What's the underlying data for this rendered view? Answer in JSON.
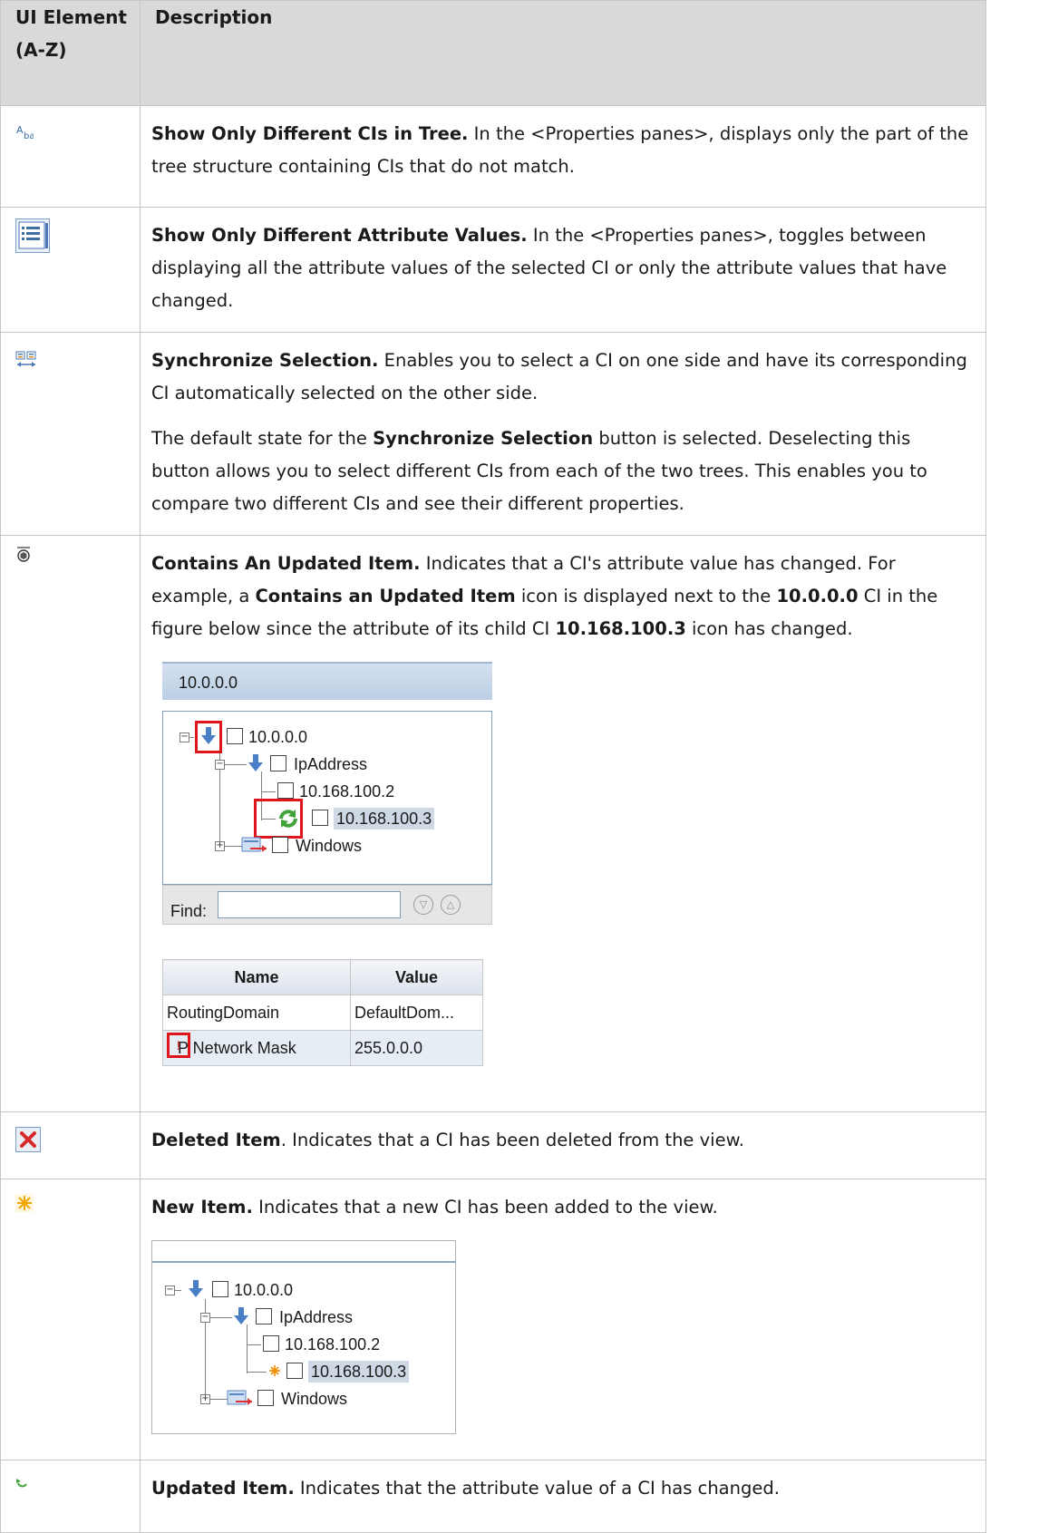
{
  "table": {
    "headers": {
      "col1": "UI Element (A-Z)",
      "col2": "Description"
    },
    "rows": [
      {
        "icon": "show-only-different-cis-icon",
        "title": "Show Only Different CIs in Tree.",
        "text": " In the <Properties panes>, displays only the part of the tree structure containing CIs that do not match."
      },
      {
        "icon": "show-only-different-attribute-values-icon",
        "title": "Show Only Different Attribute Values.",
        "text": " In the <Properties panes>, toggles between displaying all the attribute values of the selected CI or only the attribute values that have changed."
      },
      {
        "icon": "synchronize-selection-icon",
        "title": "Synchronize Selection.",
        "text": " Enables you to select a CI on one side and have its corresponding CI automatically selected on the other side.",
        "p2_a": "The default state for the ",
        "p2_b": "Synchronize Selection",
        "p2_c": " button is selected. Deselecting this button allows you to select different CIs from each of the two trees. This enables you to compare two different CIs and see their different properties."
      },
      {
        "icon": "contains-updated-item-icon",
        "title": "Contains An Updated Item.",
        "t1": " Indicates that a CI's attribute value has changed. For example, a ",
        "t2": "Contains an Updated Item",
        "t3": " icon is displayed next to the ",
        "t4": "10.0.0.0",
        "t5": " CI in the figure below since the attribute of its child CI ",
        "t6": "10.168.100.3",
        "t7": " icon has changed.",
        "figure": {
          "title": "10.0.0.0",
          "nodes": [
            "10.0.0.0",
            "IpAddress",
            "10.168.100.2",
            "10.168.100.3",
            "Windows"
          ],
          "find_label": "Find:",
          "props_headers": [
            "Name",
            "Value"
          ],
          "props_rows": [
            [
              "RoutingDomain",
              "DefaultDom..."
            ],
            [
              "P Network Mask",
              "255.0.0.0"
            ]
          ]
        }
      },
      {
        "icon": "deleted-item-icon",
        "title": "Deleted Item",
        "text": ". Indicates that a CI has been deleted from the view."
      },
      {
        "icon": "new-item-icon",
        "title": "New Item.",
        "text": " Indicates that a new CI has been added to the view.",
        "figure": {
          "nodes": [
            "10.0.0.0",
            "IpAddress",
            "10.168.100.2",
            "10.168.100.3",
            "Windows"
          ]
        }
      },
      {
        "icon": "updated-item-icon",
        "title": "Updated Item.",
        "text": " Indicates that the attribute value of a CI has changed."
      }
    ]
  }
}
